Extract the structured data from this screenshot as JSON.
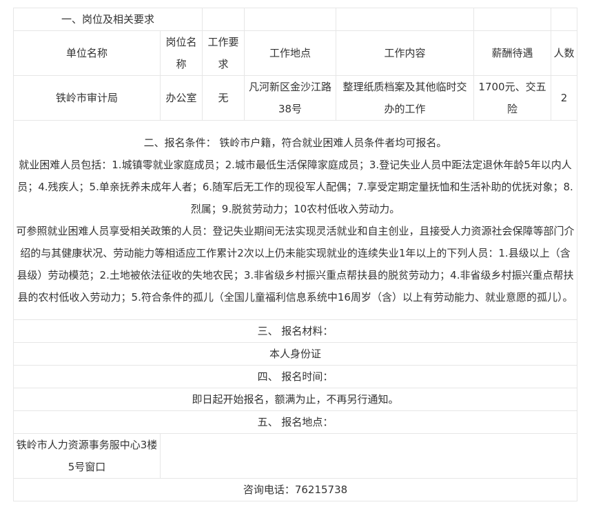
{
  "sections": {
    "one_title": "一、岗位及相关要求",
    "two_intro": "二、报名条件： 铁岭市户籍，符合就业困难人员条件者均可报名。",
    "difficult_persons": "就业困难人员包括：1.城镇零就业家庭成员；2.城市最低生活保障家庭成员；3.登记失业人员中距法定退休年龄5年以内人员；4.残疾人；5.单亲抚养未成年人者；6.随军后无工作的现役军人配偶；7.享受定期定量抚恤和生活补助的优抚对象；8.烈属；9.脱贫劳动力；10农村低收入劳动力。",
    "reference_persons": "可参照就业困难人员享受相关政策的人员：登记失业期间无法实现灵活就业和自主创业，且接受人力资源社会保障等部门介绍的与其健康状况、劳动能力等相适应工作累计2次以上仍未能实现就业的连续失业1年以上的下列人员：1.县级以上（含县级）劳动模范；2.土地被依法征收的失地农民；3.非省级乡村振兴重点帮扶县的脱贫劳动力；4.非省级乡村振兴重点帮扶县的农村低收入劳动力；5.符合条件的孤儿（全国儿童福利信息系统中16周岁（含）以上有劳动能力、就业意愿的孤儿）。",
    "three_title": "三、 报名材料：",
    "three_content": "本人身份证",
    "four_title": "四、 报名时间：",
    "four_content": "即日起开始报名，额满为止，不再另行通知。",
    "five_title": "五、 报名地点：",
    "five_location": "铁岭市人力资源事务服中心3楼5号窗口",
    "phone": "咨询电话：76215738"
  },
  "job_table": {
    "headers": [
      "单位名称",
      "岗位名称",
      "工作要求",
      "工作地点",
      "工作内容",
      "薪酬待遇",
      "人数"
    ],
    "row": [
      "铁岭市审计局",
      "办公室",
      "无",
      "凡河新区金沙江路38号",
      "整理纸质档案及其他临时交办的工作",
      "1700元、交五险",
      "2"
    ]
  }
}
